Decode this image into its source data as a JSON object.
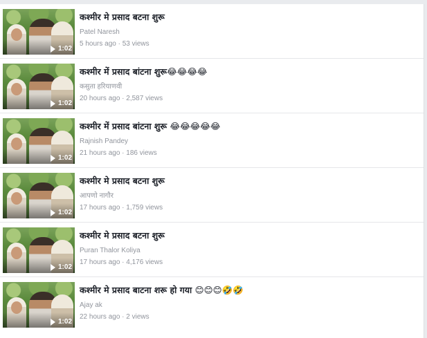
{
  "videos": [
    {
      "title": "कश्मीर मे प्रसाद बटना शुरू",
      "author": "Patel Naresh",
      "meta": "5 hours ago · 53 views",
      "duration": "1:02"
    },
    {
      "title": "कश्मीर में प्रसाद बांटना शुरू😂😂😂😂",
      "author": "कसुता हरियाणवी",
      "meta": "20 hours ago · 2,587 views",
      "duration": "1:02"
    },
    {
      "title": "कश्मीर में प्रसाद बांटना शुरू 😂😂😂😂😂",
      "author": "Rajnish Pandey",
      "meta": "21 hours ago · 186 views",
      "duration": "1:02"
    },
    {
      "title": "कश्मीर मे प्रसाद बटना शुरू",
      "author": "आपणो नागौर",
      "meta": "17 hours ago · 1,759 views",
      "duration": "1:02"
    },
    {
      "title": "कश्मीर मे प्रसाद बटना शुरू",
      "author": "Puran Thalor Koliya",
      "meta": "17 hours ago · 4,176 views",
      "duration": "1:02"
    },
    {
      "title": "कश्मीर मे प्रसाद बाटना शरू हो गया 😊😊😊🤣🤣",
      "author": "Ajay ak",
      "meta": "22 hours ago · 2 views",
      "duration": "1:02"
    }
  ]
}
